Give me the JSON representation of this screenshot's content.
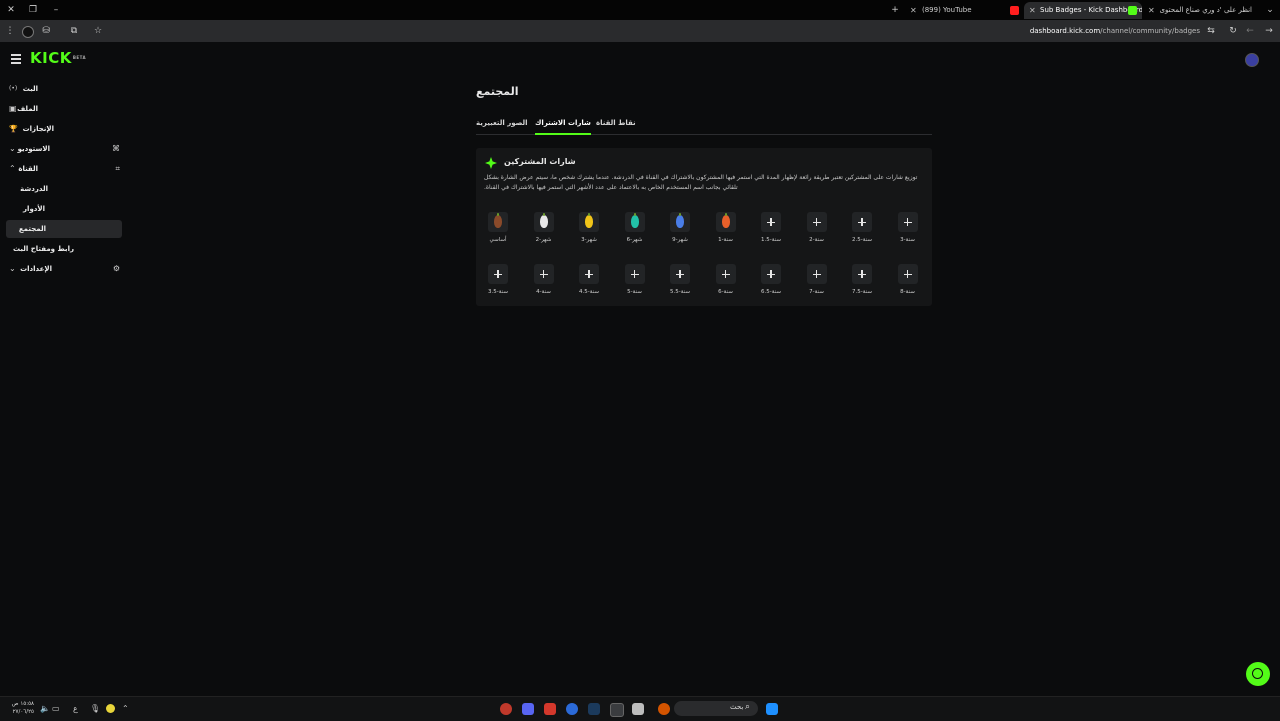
{
  "browser": {
    "tabs": [
      {
        "title": "(899) YouTube",
        "active": false
      },
      {
        "title": "Sub Badges - Kick Dashboard",
        "active": true
      },
      {
        "title": "انظر على 'د وري صناع المحتوى'",
        "active": false
      }
    ],
    "url_host": "dashboard.kick.com",
    "url_path": "/channel/community/badges"
  },
  "app": {
    "logo": "KICK",
    "logo_sup": "BETA"
  },
  "sidebar": {
    "items": [
      {
        "label": "البث",
        "icon": "broadcast-icon",
        "glyph": "(•)"
      },
      {
        "label": "الملف",
        "icon": "profile-icon",
        "glyph": "▣"
      },
      {
        "label": "الإنجازات",
        "icon": "trophy-icon",
        "glyph": "🏆"
      },
      {
        "label": "الاستوديو",
        "icon": "chevron-down-icon",
        "glyph": "⌄"
      },
      {
        "label": "القناة",
        "icon": "chevron-up-icon",
        "glyph": "⌃"
      },
      {
        "label": "الدردشة",
        "icon": "",
        "glyph": ""
      },
      {
        "label": "الأدوار",
        "icon": "",
        "glyph": ""
      },
      {
        "label": "المجتمع",
        "icon": "",
        "glyph": ""
      },
      {
        "label": "رابط ومفتاح البث",
        "icon": "",
        "glyph": ""
      },
      {
        "label": "الإعدادات",
        "icon": "chevron-down-icon",
        "glyph": "⌄"
      }
    ]
  },
  "main": {
    "title": "المجتمع",
    "tabs": [
      {
        "label": "الصور التعبيرية",
        "active": false
      },
      {
        "label": "شارات الاشتراك",
        "active": true
      },
      {
        "label": "نقاط القناة",
        "active": false
      }
    ],
    "card": {
      "title": "شارات المشتركين",
      "description": "توزيع شارات على المشتركين تعتبر طريقة رائعة لإظهار المدة التي استمر فيها المشتركون بالاشتراك في القناة في الدردشة. عندما يشترك شخص ما، سيتم عرض الشارة بشكل تلقائي بجانب اسم المستخدم الخاص به بالاعتماد على عدد الأشهر التي استمر فيها بالاشتراك في القناة.",
      "badges": [
        {
          "label": "أساسي",
          "filled": true,
          "color": "#8a4a2a"
        },
        {
          "label": "شهر-2",
          "filled": true,
          "color": "#e8e8e8"
        },
        {
          "label": "شهر-3",
          "filled": true,
          "color": "#f0c419"
        },
        {
          "label": "شهر-6",
          "filled": true,
          "color": "#22c1a8"
        },
        {
          "label": "شهر-9",
          "filled": true,
          "color": "#4a7ee8"
        },
        {
          "label": "سنة-1",
          "filled": true,
          "color": "#e8602a"
        },
        {
          "label": "سنة-1.5",
          "filled": false
        },
        {
          "label": "سنة-2",
          "filled": false
        },
        {
          "label": "سنة-2.5",
          "filled": false
        },
        {
          "label": "سنة-3",
          "filled": false
        },
        {
          "label": "سنة-3.5",
          "filled": false
        },
        {
          "label": "سنة-4",
          "filled": false
        },
        {
          "label": "سنة-4.5",
          "filled": false
        },
        {
          "label": "سنة-5",
          "filled": false
        },
        {
          "label": "سنة-5.5",
          "filled": false
        },
        {
          "label": "سنة-6",
          "filled": false
        },
        {
          "label": "سنة-6.5",
          "filled": false
        },
        {
          "label": "سنة-7",
          "filled": false
        },
        {
          "label": "سنة-7.5",
          "filled": false
        },
        {
          "label": "سنة-8",
          "filled": false
        }
      ]
    }
  },
  "taskbar": {
    "search_label": "بحث",
    "clock_time": "١٥:٥٨ ص",
    "clock_date": "٢٧/٠٦/٢٥",
    "lang": "ع"
  },
  "colors": {
    "accent": "#53fc18",
    "background": "#0b0c0d",
    "card": "#151617"
  }
}
